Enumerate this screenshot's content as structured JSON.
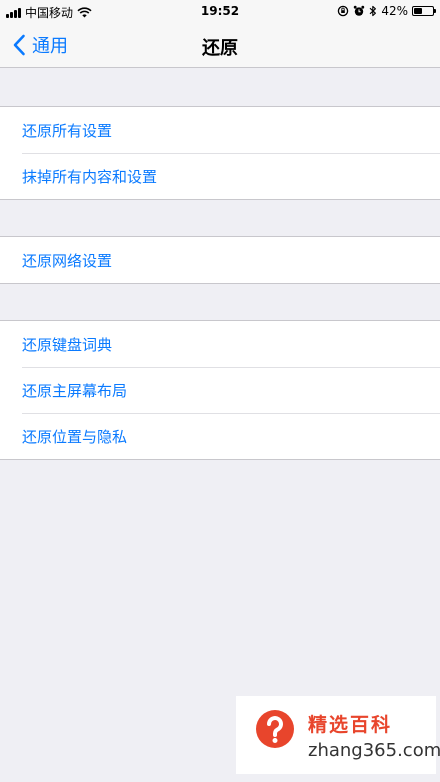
{
  "status_bar": {
    "carrier": "中国移动",
    "time": "19:52",
    "battery_percent": "42%",
    "battery_level": 0.42,
    "icons": [
      "signal-icon",
      "wifi-icon",
      "lock-rotation-icon",
      "alarm-icon",
      "bluetooth-icon",
      "battery-icon"
    ]
  },
  "nav": {
    "back_label": "通用",
    "title": "还原"
  },
  "groups": [
    {
      "items": [
        "还原所有设置",
        "抹掉所有内容和设置"
      ]
    },
    {
      "items": [
        "还原网络设置"
      ]
    },
    {
      "items": [
        "还原键盘词典",
        "还原主屏幕布局",
        "还原位置与隐私"
      ]
    }
  ],
  "watermark": {
    "title": "精选百科",
    "url": "zhang365.com"
  },
  "colors": {
    "accent": "#0a7aff",
    "background": "#efeff4",
    "watermark_red": "#e8452c"
  }
}
